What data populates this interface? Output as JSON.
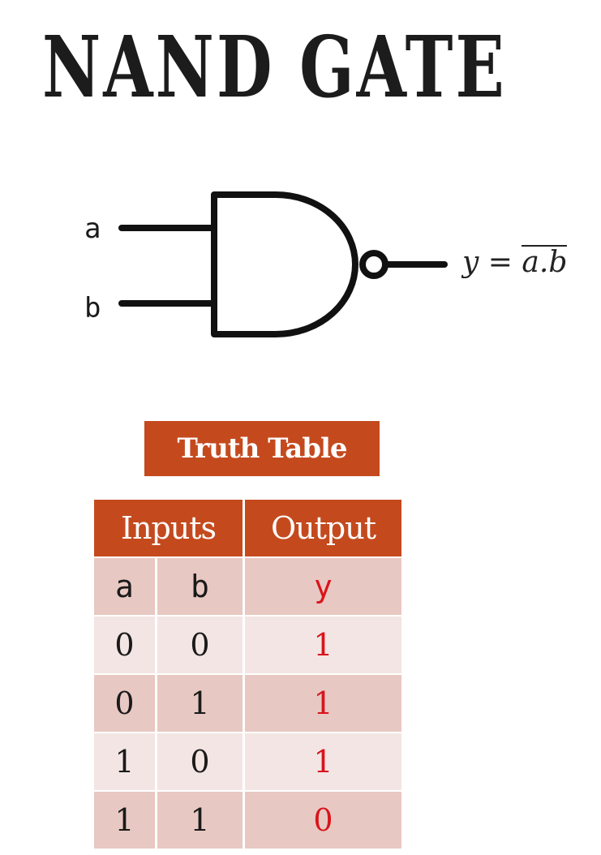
{
  "title": "NAND GATE",
  "gate": {
    "input_a": "a",
    "input_b": "b",
    "equation_lhs": "y =",
    "equation_rhs": "a.b"
  },
  "truth_table": {
    "caption": "Truth Table",
    "group_inputs": "Inputs",
    "group_output": "Output",
    "col_a": "a",
    "col_b": "b",
    "col_y": "y",
    "rows": [
      {
        "a": "0",
        "b": "0",
        "y": "1"
      },
      {
        "a": "0",
        "b": "1",
        "y": "1"
      },
      {
        "a": "1",
        "b": "0",
        "y": "1"
      },
      {
        "a": "1",
        "b": "1",
        "y": "0"
      }
    ]
  },
  "colors": {
    "accent": "#c44a1e",
    "row_dark": "#e8c8c2",
    "row_light": "#f3e5e3",
    "output_text": "#d9141c"
  }
}
